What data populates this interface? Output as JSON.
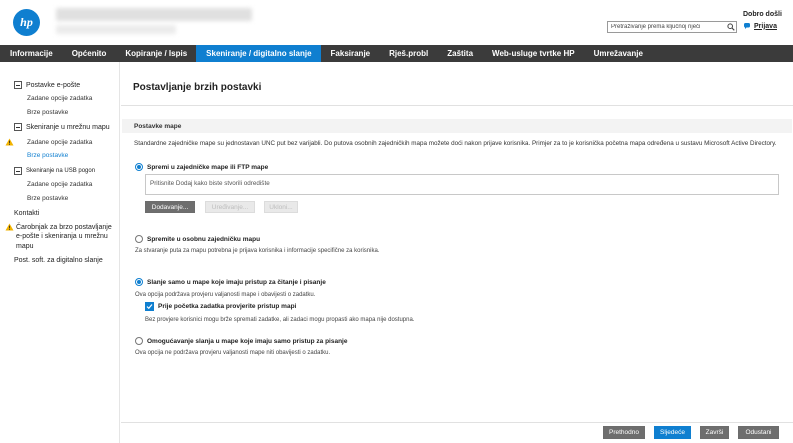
{
  "colors": {
    "brand": "#0f7fd0",
    "nav_bg": "#3b3b3b",
    "warning": "#f2b300",
    "button_gray": "#6e6e6e"
  },
  "header": {
    "logo_text": "hp",
    "search_placeholder": "Pretraživanje prema ključnoj riječi",
    "welcome": "Dobro došli",
    "sign_in": "Prijava"
  },
  "nav": {
    "items": [
      {
        "label": "Informacije"
      },
      {
        "label": "Općenito"
      },
      {
        "label": "Kopiranje / Ispis"
      },
      {
        "label": "Skeniranje / digitalno slanje",
        "active": true
      },
      {
        "label": "Faksiranje"
      },
      {
        "label": "Rješ.probl"
      },
      {
        "label": "Zaštita"
      },
      {
        "label": "Web-usluge tvrtke HP"
      },
      {
        "label": "Umrežavanje"
      }
    ]
  },
  "sidebar": {
    "email_setup": "Postavke e-pošte",
    "email_defaults": "Zadane opcije zadatka",
    "email_quick": "Brze postavke",
    "network_folder": "Skeniranje u mrežnu mapu",
    "folder_defaults": "Zadane opcije zadatka",
    "folder_quick": "Brze postavke",
    "usb": "Skeniranje na USB pogon",
    "usb_defaults": "Zadane opcije zadatka",
    "usb_quick": "Brze postavke",
    "contacts": "Kontakti",
    "wizard_line1": "Čarobnjak za brzo postavljanje",
    "wizard_line2": "e-pošte i skeniranja u mrežnu",
    "wizard_line3": "mapu",
    "digital_send": "Post. soft. za digitalno slanje"
  },
  "content": {
    "title": "Postavljanje brzih postavki",
    "section": "Postavke mape",
    "description": "Standardne zajedničke mape su jednostavan UNC put bez varijabli. Do putova osobnih zajedničkih mapa možete doći nakon prijave korisnika. Primjer za to je korisnička početna mapa određena u sustavu Microsoft Active Directory.",
    "opt_shared": "Spremi u zajedničke mape ili FTP mape",
    "list_placeholder": "Pritisnite Dodaj kako biste stvorili odredište",
    "btn_add": "Dodavanje...",
    "btn_edit": "Uređivanje...",
    "btn_remove": "Ukloni...",
    "opt_personal": "Spremite u osobnu zajedničku mapu",
    "personal_note": "Za stvaranje puta za mapu potrebna je prijava korisnika i informacije specifične za korisnika.",
    "opt_rw": "Slanje samo u mape koje imaju pristup za čitanje i pisanje",
    "rw_note": "Ova opcija podržava provjeru valjanosti mape i obavijesti o zadatku.",
    "chk_verify": "Prije početka zadatka provjerite pristup mapi",
    "verify_note": "Bez provjere korisnici mogu brže spremati zadatke, ali zadaci mogu propasti ako mapa nije dostupna.",
    "opt_write_only": "Omogućavanje slanja u mape koje imaju samo pristup za pisanje",
    "write_only_note": "Ova opcija ne podržava provjeru valjanosti mape niti obavijesti o zadatku."
  },
  "footer": {
    "prev": "Prethodno",
    "next": "Sljedeće",
    "finish": "Završi",
    "cancel": "Odustani"
  }
}
